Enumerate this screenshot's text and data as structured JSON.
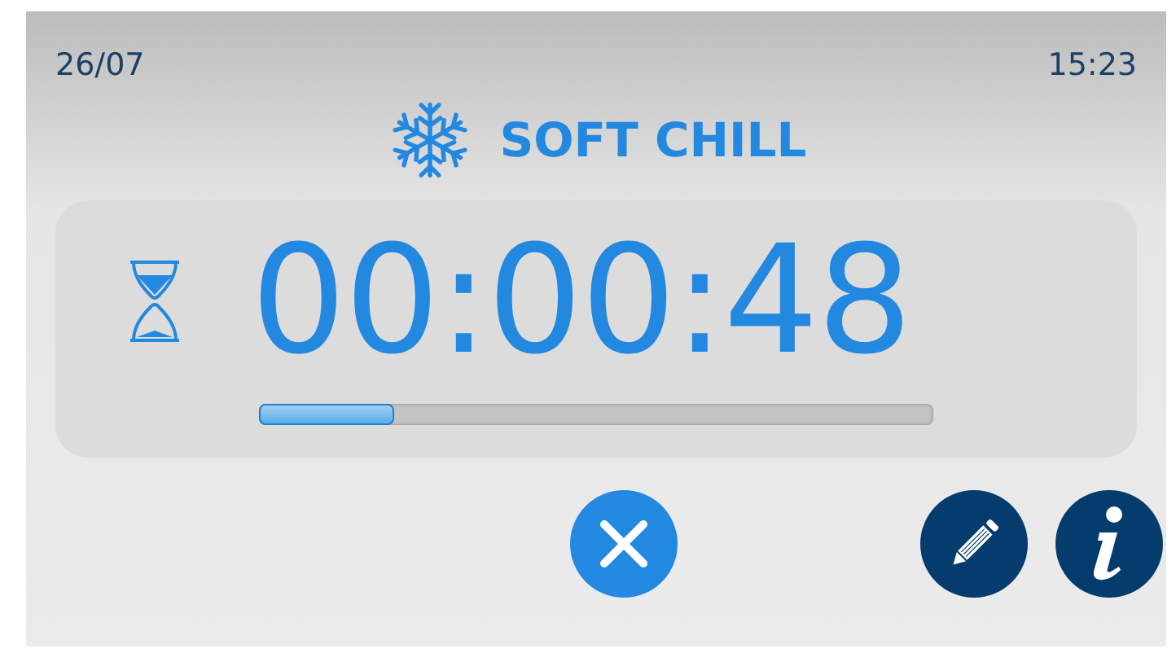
{
  "status_bar": {
    "date": "26/07",
    "time": "15:23"
  },
  "program": {
    "title": "SOFT CHILL"
  },
  "timer": {
    "time": "00:00:48",
    "level": 0.2
  },
  "buttons": [
    {
      "kind": "cancel"
    },
    {
      "kind": "edit"
    },
    {
      "kind": "info"
    }
  ]
}
